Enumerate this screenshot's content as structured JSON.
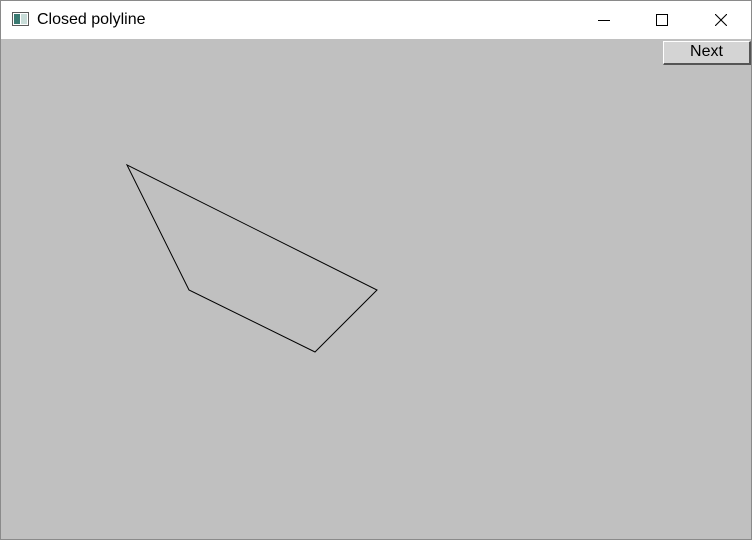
{
  "window": {
    "title": "Closed polyline",
    "controls": {
      "minimize": "minimize-icon",
      "maximize": "maximize-icon",
      "close": "close-icon"
    }
  },
  "toolbar": {
    "next_label": "Next"
  },
  "colors": {
    "client_background": "#c0c0c0",
    "polyline_stroke": "#000000",
    "titlebar_background": "#ffffff"
  }
}
